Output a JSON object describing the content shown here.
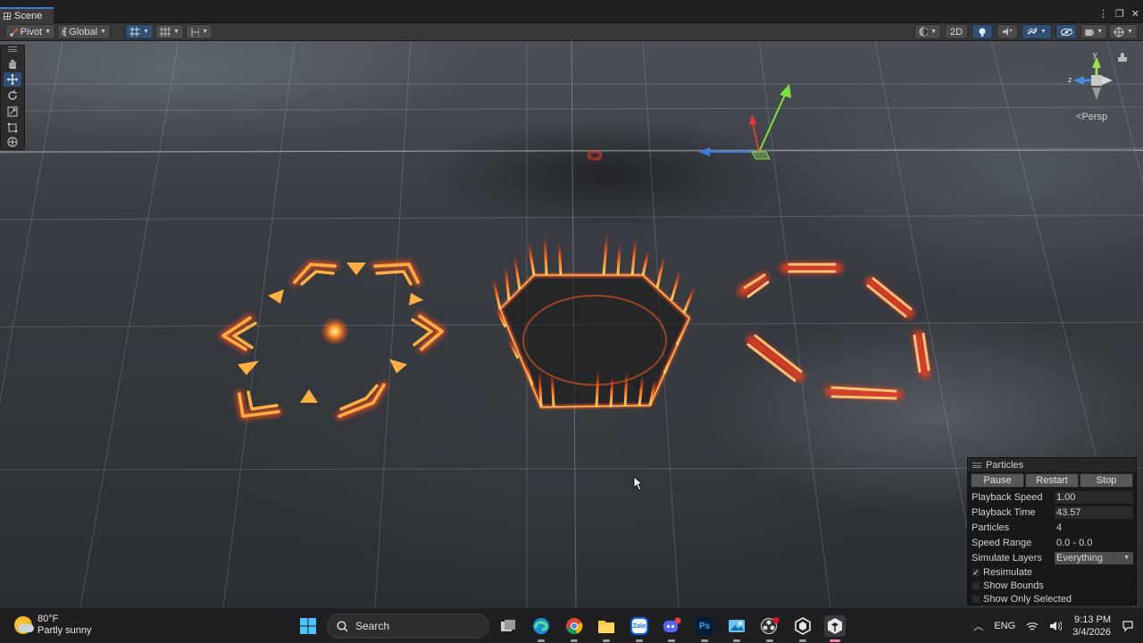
{
  "window": {
    "tab_title": "Scene",
    "controls": [
      "⋮",
      "❐",
      "✕"
    ]
  },
  "toolbar": {
    "pivot_label": "Pivot",
    "global_label": "Global",
    "mode_2d_label": "2D"
  },
  "gizmo": {
    "axis_y": "y",
    "axis_z": "z",
    "projection_label": "Persp"
  },
  "particles_panel": {
    "title": "Particles",
    "buttons": {
      "pause": "Pause",
      "restart": "Restart",
      "stop": "Stop"
    },
    "rows": [
      {
        "label": "Playback Speed",
        "value": "1.00"
      },
      {
        "label": "Playback Time",
        "value": "43.57"
      },
      {
        "label": "Particles",
        "value": "4"
      },
      {
        "label": "Speed Range",
        "value": "0.0 - 0.0"
      },
      {
        "label": "Simulate Layers",
        "value": "Everything"
      }
    ],
    "checks": [
      {
        "label": "Resimulate",
        "checked": true,
        "mark": "✓"
      },
      {
        "label": "Show Bounds",
        "checked": false,
        "mark": ""
      },
      {
        "label": "Show Only Selected",
        "checked": false,
        "mark": ""
      }
    ]
  },
  "taskbar": {
    "weather_temp": "80°F",
    "weather_desc": "Partly sunny",
    "search_placeholder": "Search",
    "language": "ENG",
    "time": "9:13 PM",
    "date": "3/4/2026",
    "apps": [
      "start-icon",
      "task-view-icon",
      "edge-icon",
      "chrome-icon",
      "file-explorer-icon",
      "zalo-icon",
      "discord-icon",
      "photoshop-icon",
      "image-editor-icon",
      "obs-icon",
      "unity-hub-icon",
      "unity-editor-icon"
    ],
    "app_labels": {
      "zalo": "Zalo",
      "photoshop": "Ps"
    }
  },
  "colors": {
    "accent": "#3c7fd0",
    "selected_tool": "#2f4f75",
    "fx_orange": "#ff9a2a",
    "fx_red": "#ff3b1e"
  }
}
